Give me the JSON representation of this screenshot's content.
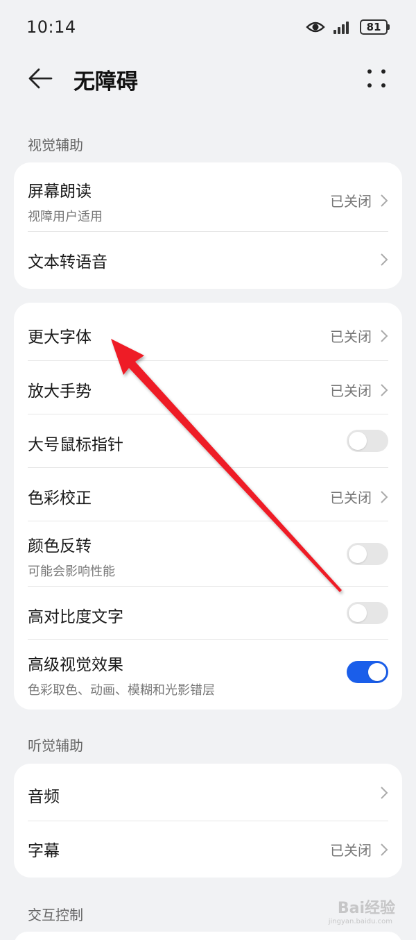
{
  "status_bar": {
    "time": "10:14",
    "battery_level": "81",
    "icons": [
      "eye-icon",
      "signal-icon",
      "battery-icon"
    ]
  },
  "header": {
    "title": "无障碍",
    "back_icon": "back-arrow-icon",
    "more_icon": "more-dots-icon"
  },
  "sections": {
    "visual": {
      "title": "视觉辅助",
      "card1": [
        {
          "title": "屏幕朗读",
          "subtitle": "视障用户适用",
          "value": "已关闭"
        },
        {
          "title": "文本转语音"
        }
      ],
      "card2": [
        {
          "title": "更大字体",
          "value": "已关闭"
        },
        {
          "title": "放大手势",
          "value": "已关闭"
        },
        {
          "title": "大号鼠标指针",
          "toggle": false
        },
        {
          "title": "色彩校正",
          "value": "已关闭"
        },
        {
          "title": "颜色反转",
          "subtitle": "可能会影响性能",
          "toggle": false
        },
        {
          "title": "高对比度文字",
          "toggle": false
        },
        {
          "title": "高级视觉效果",
          "subtitle": "色彩取色、动画、模糊和光影错层",
          "toggle": true
        }
      ]
    },
    "hearing": {
      "title": "听觉辅助",
      "items": [
        {
          "title": "音频"
        },
        {
          "title": "字幕",
          "value": "已关闭"
        }
      ]
    },
    "interaction": {
      "title": "交互控制"
    }
  },
  "watermark": {
    "text": "Bai经验",
    "sub": "jingyan.baidu.com"
  },
  "colors": {
    "background": "#f1f2f4",
    "card": "#ffffff",
    "toggle_on": "#1a5eea",
    "toggle_off": "#e6e6e6",
    "annotation_arrow": "#ee1c25"
  }
}
